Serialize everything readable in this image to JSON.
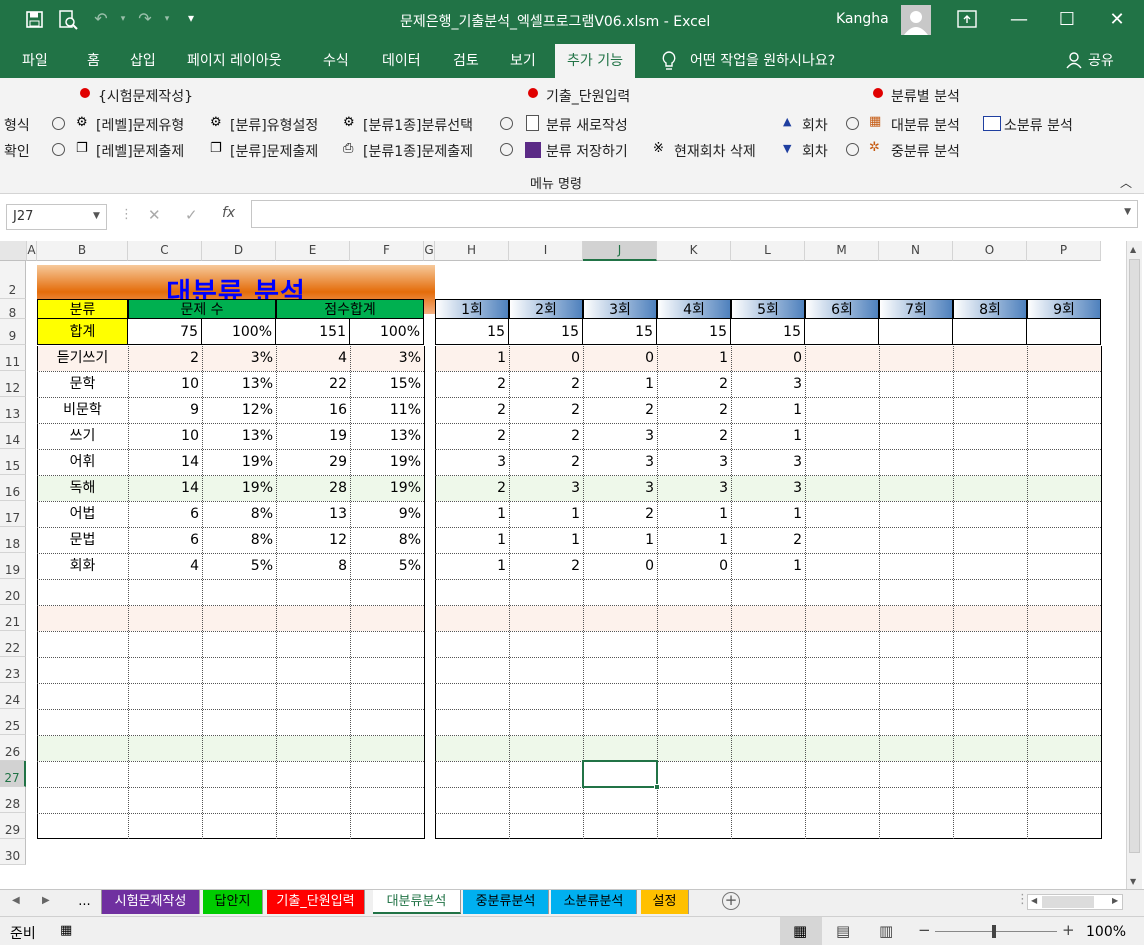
{
  "window": {
    "title": "문제은행_기출분석_엑셀프로그램V06.xlsm  -  Excel",
    "user": "Kangha"
  },
  "tabs": [
    "파일",
    "홈",
    "삽입",
    "페이지 레이아웃",
    "수식",
    "데이터",
    "검토",
    "보기",
    "추가 기능"
  ],
  "tell_me": "어떤 작업을 원하시나요?",
  "share": "공유",
  "ribbon": {
    "group_label": "메뉴 명령",
    "g1_title": "{시험문제작성}",
    "g1_row1": [
      "[레벨]문제유형",
      "[분류]유형설정",
      "[분류1종]분류선택"
    ],
    "g1_row2": [
      "[레벨]문제출제",
      "[분류]문제출제",
      "[분류1종]문제출제"
    ],
    "g1_cut1": "형식",
    "g1_cut2": "확인",
    "g2_title": "기출_단원입력",
    "g2_row1": "분류 새로작성",
    "g2_row2": "분류 저장하기",
    "g2_row2b": "현재회차 삭제",
    "g3_title": "분류별 분석",
    "g3_row1a": "회차",
    "g3_row1b": "대분류 분석",
    "g3_row1c": "소분류 분석",
    "g3_row2a": "회차",
    "g3_row2b": "중분류 분석"
  },
  "formula_bar": {
    "name_box": "J27",
    "fx": "fx",
    "formula": ""
  },
  "columns": [
    "A",
    "B",
    "C",
    "D",
    "E",
    "F",
    "G",
    "H",
    "I",
    "J",
    "K",
    "L",
    "M",
    "N",
    "O",
    "P"
  ],
  "rows": [
    "2",
    "8",
    "9",
    "11",
    "12",
    "13",
    "14",
    "15",
    "16",
    "17",
    "18",
    "19",
    "20",
    "21",
    "22",
    "23",
    "24",
    "25",
    "26",
    "27",
    "28",
    "29",
    "30"
  ],
  "sheet": {
    "title": "대분류 분석",
    "hdr_cat": "분류",
    "hdr_count": "문제 수",
    "hdr_score": "점수합계",
    "total_label": "합계",
    "total_count": "75",
    "total_count_pct": "100%",
    "total_score": "151",
    "total_score_pct": "100%",
    "rounds": [
      "1회",
      "2회",
      "3회",
      "4회",
      "5회",
      "6회",
      "7회",
      "8회",
      "9회"
    ],
    "round_totals": [
      "15",
      "15",
      "15",
      "15",
      "15",
      "",
      "",
      "",
      ""
    ],
    "data": [
      [
        "듣기쓰기",
        "2",
        "3%",
        "4",
        "3%",
        "1",
        "0",
        "0",
        "1",
        "0"
      ],
      [
        "문학",
        "10",
        "13%",
        "22",
        "15%",
        "2",
        "2",
        "1",
        "2",
        "3"
      ],
      [
        "비문학",
        "9",
        "12%",
        "16",
        "11%",
        "2",
        "2",
        "2",
        "2",
        "1"
      ],
      [
        "쓰기",
        "10",
        "13%",
        "19",
        "13%",
        "2",
        "2",
        "3",
        "2",
        "1"
      ],
      [
        "어휘",
        "14",
        "19%",
        "29",
        "19%",
        "3",
        "2",
        "3",
        "3",
        "3"
      ],
      [
        "독해",
        "14",
        "19%",
        "28",
        "19%",
        "2",
        "3",
        "3",
        "3",
        "3"
      ],
      [
        "어법",
        "6",
        "8%",
        "13",
        "9%",
        "1",
        "1",
        "2",
        "1",
        "1"
      ],
      [
        "문법",
        "6",
        "8%",
        "12",
        "8%",
        "1",
        "1",
        "1",
        "1",
        "2"
      ],
      [
        "회화",
        "4",
        "5%",
        "8",
        "5%",
        "1",
        "2",
        "0",
        "0",
        "1"
      ]
    ]
  },
  "sheet_tabs": [
    "...",
    "시험문제작성",
    "답안지",
    "기출_단원입력",
    "대분류분석",
    "중분류분석",
    "소분류분석",
    "설정"
  ],
  "sheet_tab_colors": [
    "#f0f0f0",
    "#7030a0",
    "#00cc00",
    "#ff0000",
    "#f0f0f0",
    "#00b0f0",
    "#00b0f0",
    "#ffc000"
  ],
  "status": {
    "ready": "준비",
    "zoom": "100%"
  },
  "colors": {
    "excel_green": "#217346",
    "yellow": "#ffff00",
    "green_hdr": "#00b050",
    "title_orange": "#e46c0a",
    "title_blue": "#0000ff"
  }
}
